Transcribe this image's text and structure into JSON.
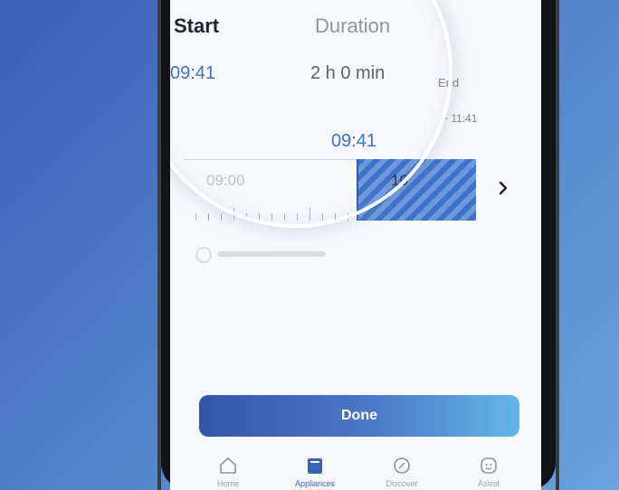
{
  "scheduler": {
    "start_label": "Start",
    "duration_label": "Duration",
    "end_label": "End",
    "start_time": "09:41",
    "duration_value": "2 h 0 min",
    "end_time": "~ 11:41",
    "pointer_time": "09:41",
    "timeline_labels": [
      "09:00",
      "10"
    ],
    "next_icon": "chevron-right-icon"
  },
  "actions": {
    "done_label": "Done"
  },
  "tabbar": {
    "items": [
      {
        "label": "Home",
        "icon": "home-icon"
      },
      {
        "label": "Appliances",
        "icon": "appliances-icon",
        "active": true
      },
      {
        "label": "Discover",
        "icon": "compass-icon"
      },
      {
        "label": "Assist",
        "icon": "smiley-icon"
      }
    ]
  },
  "colors": {
    "accent": "#3b73c8",
    "button_gradient_start": "#3556a8",
    "button_gradient_end": "#62b6ea",
    "background": "#f7f8fc"
  }
}
